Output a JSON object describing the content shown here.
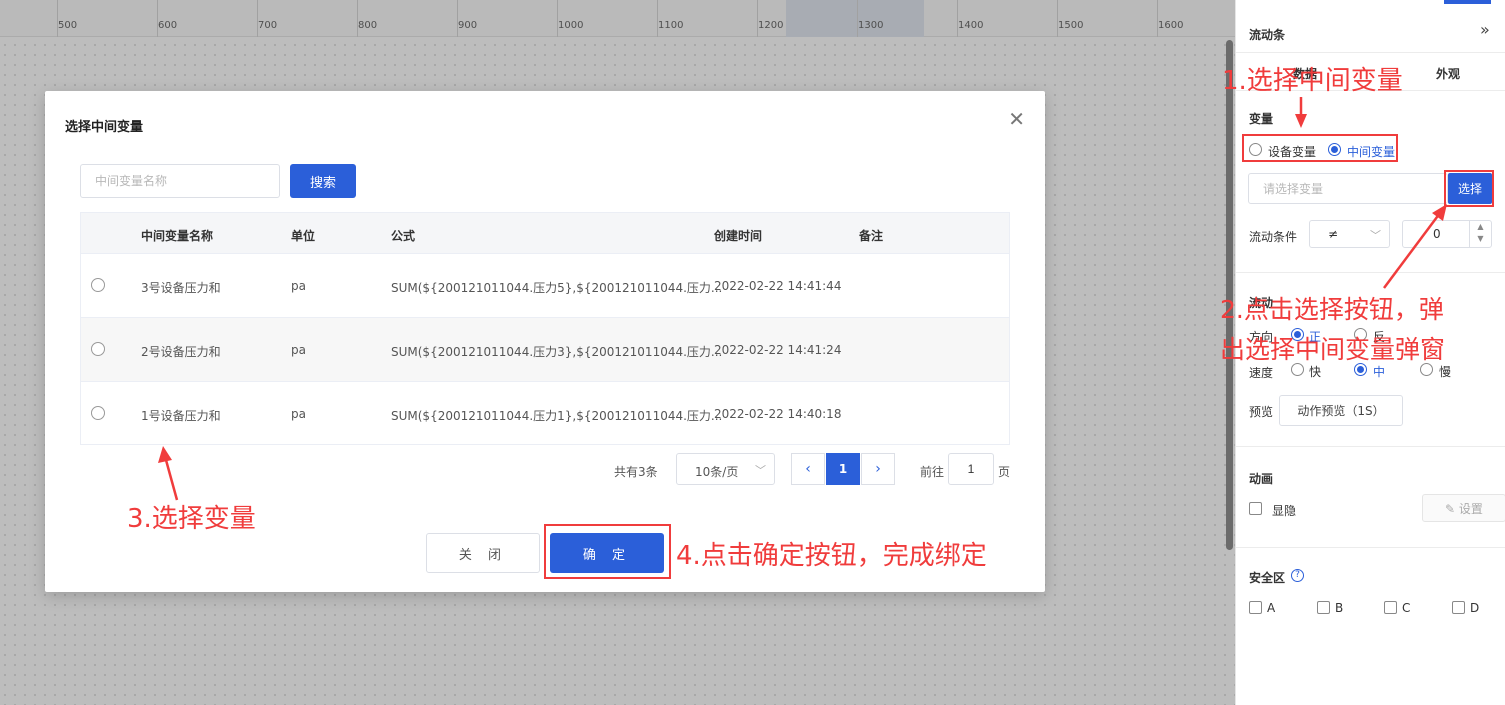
{
  "ruler": {
    "labels": [
      "500",
      "600",
      "700",
      "800",
      "900",
      "1000",
      "1100",
      "1200",
      "1300",
      "1400",
      "1500",
      "1600"
    ]
  },
  "modal": {
    "title": "选择中间变量",
    "search_placeholder": "中间变量名称",
    "search_button": "搜索",
    "columns": [
      "中间变量名称",
      "单位",
      "公式",
      "创建时间",
      "备注"
    ],
    "rows": [
      {
        "name": "3号设备压力和",
        "unit": "pa",
        "formula": "SUM(${200121011044.压力5},${200121011044.压力...",
        "created": "2022-02-22 14:41:44",
        "note": "",
        "selected": false
      },
      {
        "name": "2号设备压力和",
        "unit": "pa",
        "formula": "SUM(${200121011044.压力3},${200121011044.压力...",
        "created": "2022-02-22 14:41:24",
        "note": "",
        "selected": false
      },
      {
        "name": "1号设备压力和",
        "unit": "pa",
        "formula": "SUM(${200121011044.压力1},${200121011044.压力...",
        "created": "2022-02-22 14:40:18",
        "note": "",
        "selected": false
      }
    ],
    "pagination": {
      "total": "共有3条",
      "page_size": "10条/页",
      "current": "1",
      "goto_label": "前往",
      "goto_value": "1",
      "goto_suffix": "页"
    },
    "close_button": "关 闭",
    "confirm_button": "确 定"
  },
  "panel": {
    "title": "流动条",
    "tabs": [
      "数据",
      "外观"
    ],
    "variable": {
      "label": "变量",
      "options": [
        {
          "label": "设备变量",
          "selected": false
        },
        {
          "label": "中间变量",
          "selected": true
        }
      ],
      "input_placeholder": "请选择变量",
      "select_button": "选择"
    },
    "flow_condition": {
      "label": "流动条件",
      "operator": "≠",
      "value": "0"
    },
    "flow": {
      "section": "流动",
      "direction_label": "方向",
      "direction_options": [
        {
          "label": "正",
          "selected": true
        },
        {
          "label": "反",
          "selected": false
        }
      ],
      "speed_label": "速度",
      "speed_options": [
        {
          "label": "快",
          "selected": false
        },
        {
          "label": "中",
          "selected": true
        },
        {
          "label": "慢",
          "selected": false
        }
      ],
      "preview_label": "预览",
      "preview_button": "动作预览（1S）"
    },
    "animation": {
      "section": "动画",
      "visible_label": "显隐",
      "settings_button": "设置"
    },
    "safe_zone": {
      "section": "安全区",
      "options": [
        "A",
        "B",
        "C",
        "D"
      ]
    }
  },
  "annotations": {
    "step1": "1.选择中间变量",
    "step2_line1": "2.点击选择按钮，弹",
    "step2_line2": "出选择中间变量弹窗",
    "step3": "3.选择变量",
    "step4": "4.点击确定按钮，完成绑定"
  },
  "colors": {
    "primary": "#2b5fd9",
    "annotation": "#f03c3c"
  }
}
